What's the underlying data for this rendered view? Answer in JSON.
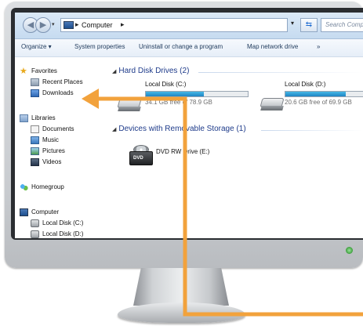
{
  "colors": {
    "arrow": "#f2a23c",
    "bar_fill": "#2b95d2",
    "header_blue": "#1e3b8a"
  },
  "addressbar": {
    "path": [
      "Computer"
    ],
    "search_placeholder": "Search Comp",
    "refresh_icon": "refresh-icon"
  },
  "toolbar": {
    "items": [
      "Organize ▾",
      "System properties",
      "Uninstall or change a program",
      "Map network drive",
      "»"
    ]
  },
  "sidebar": {
    "favorites": {
      "label": "Favorites",
      "items": [
        "Recent Places",
        "Downloads"
      ]
    },
    "libraries": {
      "label": "Libraries",
      "items": [
        "Documents",
        "Music",
        "Pictures",
        "Videos"
      ]
    },
    "homegroup": {
      "label": "Homegroup"
    },
    "computer": {
      "label": "Computer",
      "items": [
        "Local Disk (C:)",
        "Local Disk (D:)"
      ]
    }
  },
  "content": {
    "hard_disk_group": "Hard Disk Drives (2)",
    "drives": [
      {
        "name": "Local Disk (C:)",
        "free_text": "34.1 GB free of 78.9 GB",
        "used_fraction": 0.57
      },
      {
        "name": "Local Disk (D:)",
        "free_text": "20.6 GB free of 69.9 GB",
        "used_fraction": 0.71
      }
    ],
    "removable_group": "Devices with Removable Storage (1)",
    "removable": [
      {
        "name": "DVD RW Drive (E:)",
        "icon_text": "DVD"
      }
    ]
  }
}
